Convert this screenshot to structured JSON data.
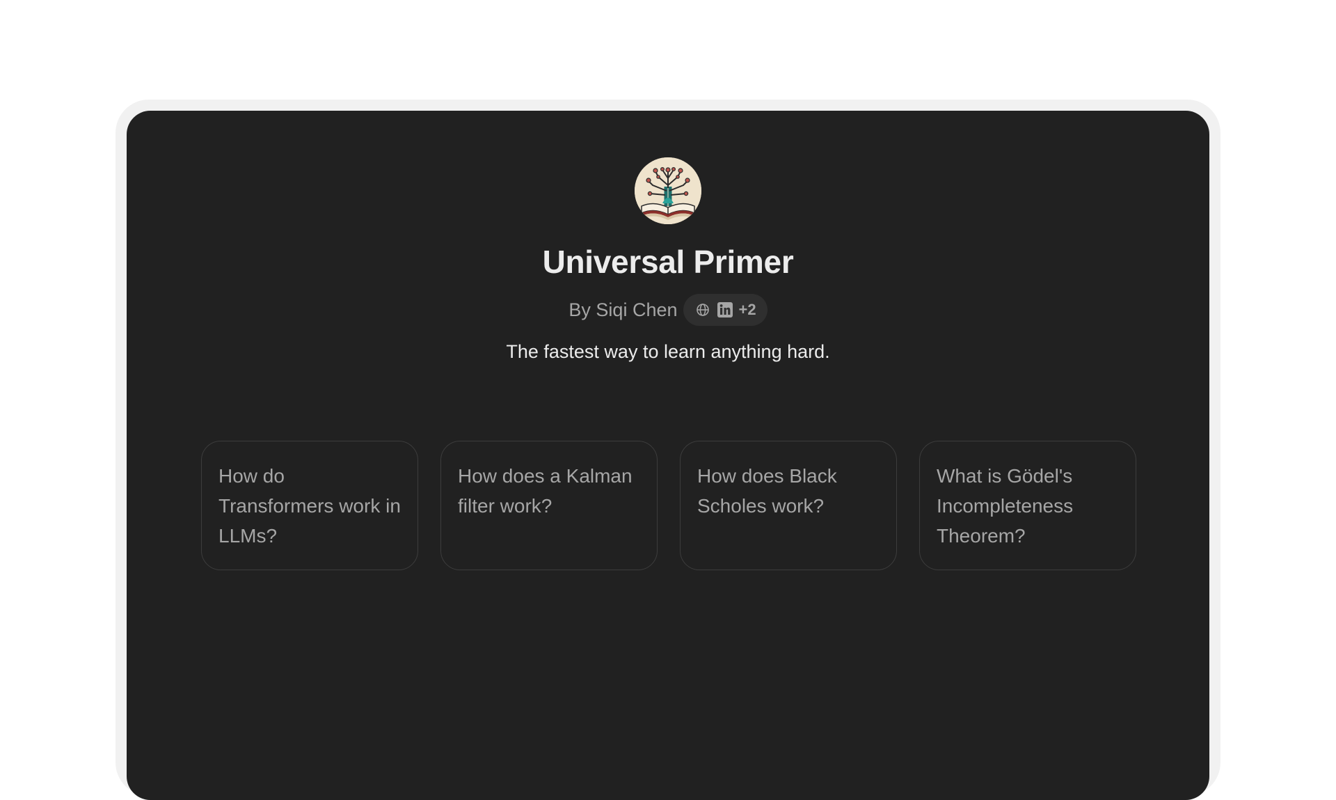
{
  "gpt": {
    "avatar_icon": "book-circuit-tree-icon",
    "title": "Universal Primer",
    "author": "By Siqi Chen",
    "social_icons": [
      "globe-icon",
      "linkedin-icon"
    ],
    "social_more": "+2",
    "description": "The fastest way to learn anything hard."
  },
  "conversation_starters": [
    "How do Transformers work in LLMs?",
    "How does a Kalman filter work?",
    "How does Black Scholes work?",
    "What is Gödel's Incompleteness Theorem?"
  ],
  "colors": {
    "page_background": "#ffffff",
    "frame": "#f1f1f1",
    "panel_background": "#212121",
    "primary_text": "#ececec",
    "secondary_text": "#a6a6a6",
    "card_border": "#3d3d3d",
    "pill_background": "#2f2f2f"
  }
}
